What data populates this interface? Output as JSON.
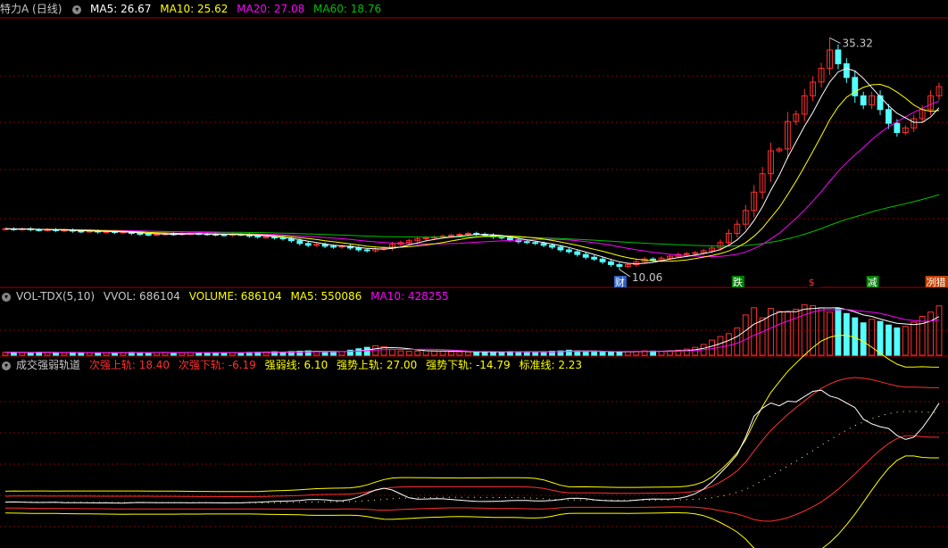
{
  "colors": {
    "bg": "#000000",
    "up": "#ff3030",
    "down": "#54ffff",
    "grid": "#800000",
    "separator": "#a00000",
    "ma5": "#ffffff",
    "ma10": "#ffff00",
    "ma20": "#ff00ff",
    "ma60": "#00c000",
    "label": "#c8c8c8"
  },
  "price_panel": {
    "title": "特力A (日线)",
    "ma": [
      {
        "label": "MA5: 26.67",
        "color": "#ffffff"
      },
      {
        "label": "MA10: 25.62",
        "color": "#ffff00"
      },
      {
        "label": "MA20: 27.08",
        "color": "#ff00ff"
      },
      {
        "label": "MA60: 18.76",
        "color": "#00c000"
      }
    ],
    "high_label": "35.32",
    "low_label": "10.06",
    "event_markers": [
      {
        "text": "财",
        "color": "#ffffff",
        "bg": "#3060c0"
      },
      {
        "text": "跌",
        "color": "#ffffff",
        "bg": "#008000"
      },
      {
        "text": "$",
        "color": "#ff3030",
        "bg": "#000000"
      },
      {
        "text": "减",
        "color": "#ffffff",
        "bg": "#008000"
      },
      {
        "text": "冽猎",
        "color": "#ffffff",
        "bg": "#c04000"
      }
    ]
  },
  "volume_panel": {
    "title": "VOL-TDX(5,10)",
    "values": [
      {
        "label": "VVOL: 686104",
        "color": "#c8c8c8"
      },
      {
        "label": "VOLUME: 686104",
        "color": "#ffff00"
      },
      {
        "label": "MA5: 550086",
        "color": "#ffff00"
      },
      {
        "label": "MA10: 428255",
        "color": "#ff00ff"
      }
    ]
  },
  "indicator_panel": {
    "title": "成交强弱轨道",
    "values": [
      {
        "label": "次强上轨: 18.40",
        "color": "#ff3030"
      },
      {
        "label": "次强下轨: -6.19",
        "color": "#ff3030"
      },
      {
        "label": "强弱线: 6.10",
        "color": "#ffff00"
      },
      {
        "label": "强势上轨: 27.00",
        "color": "#ffff00"
      },
      {
        "label": "强势下轨: -14.79",
        "color": "#ffff00"
      },
      {
        "label": "标准线: 2.23",
        "color": "#ffff00"
      }
    ]
  },
  "chart_data": {
    "type": "candlestick",
    "title": "特力A (日线)",
    "x_unit": "trading day index",
    "ylim": [
      8.5,
      37.5
    ],
    "high": 35.32,
    "low": 10.06,
    "ma_last": {
      "MA5": 26.67,
      "MA10": 25.62,
      "MA20": 27.08,
      "MA60": 18.76
    },
    "closes": [
      14.5,
      14.45,
      14.5,
      14.4,
      14.35,
      14.4,
      14.3,
      14.35,
      14.25,
      14.2,
      14.25,
      14.15,
      14.2,
      14.1,
      14.15,
      14.0,
      13.9,
      13.85,
      13.9,
      13.95,
      13.9,
      13.95,
      14.0,
      13.95,
      13.9,
      13.85,
      13.8,
      13.9,
      13.85,
      13.7,
      13.6,
      13.6,
      13.5,
      13.4,
      13.2,
      12.9,
      12.7,
      12.8,
      12.6,
      12.5,
      12.6,
      12.4,
      12.2,
      12.1,
      12.3,
      12.4,
      12.8,
      13.0,
      13.2,
      13.4,
      13.5,
      13.6,
      13.7,
      13.8,
      13.9,
      14.0,
      13.9,
      13.8,
      13.6,
      13.5,
      13.3,
      13.1,
      13.0,
      12.9,
      12.7,
      12.5,
      12.2,
      12.0,
      11.7,
      11.4,
      11.2,
      10.9,
      10.6,
      10.4,
      10.6,
      10.9,
      11.2,
      11.1,
      11.3,
      11.5,
      11.7,
      11.8,
      11.9,
      12.1,
      12.4,
      13.0,
      14.0,
      15.0,
      16.5,
      18.5,
      20.5,
      23.0,
      23.2,
      26.2,
      27.0,
      29.0,
      30.5,
      32.0,
      34.0,
      32.5,
      31.0,
      29.0,
      28.0,
      29.0,
      27.5,
      26.0,
      25.0,
      25.5,
      26.5,
      27.5,
      29.0,
      30.0
    ],
    "volume": {
      "ylim": [
        0,
        720000
      ],
      "last": 686104,
      "ma5_last": 550086,
      "ma10_last": 428255,
      "values": [
        40000,
        42000,
        38000,
        36000,
        41000,
        39000,
        37000,
        35000,
        38000,
        36000,
        34000,
        37000,
        35000,
        33000,
        36000,
        40000,
        38000,
        35000,
        37000,
        39000,
        34000,
        36000,
        38000,
        35000,
        37000,
        36000,
        34000,
        38000,
        36000,
        40000,
        42000,
        45000,
        48000,
        44000,
        50000,
        55000,
        60000,
        52000,
        48000,
        46000,
        50000,
        70000,
        90000,
        110000,
        130000,
        120000,
        80000,
        60000,
        55000,
        58000,
        62000,
        60000,
        56000,
        50000,
        48000,
        45000,
        42000,
        44000,
        46000,
        48000,
        52000,
        50000,
        47000,
        45000,
        48000,
        55000,
        60000,
        70000,
        58000,
        52000,
        50000,
        48000,
        45000,
        47000,
        52000,
        56000,
        60000,
        58000,
        55000,
        60000,
        70000,
        85000,
        110000,
        150000,
        210000,
        260000,
        300000,
        380000,
        560000,
        660000,
        520000,
        650000,
        610000,
        600000,
        640000,
        700000,
        690000,
        660000,
        600000,
        650000,
        580000,
        520000,
        450000,
        500000,
        470000,
        420000,
        380000,
        400000,
        460000,
        540000,
        600000,
        686104
      ]
    },
    "indicator": {
      "name": "成交强弱轨道",
      "ylim": [
        -27,
        43
      ],
      "last": {
        "次强上轨": 18.4,
        "次强下轨": -6.19,
        "强弱线": 6.1,
        "强势上轨": 27.0,
        "强势下轨": -14.79,
        "标准线": 2.23
      }
    }
  }
}
